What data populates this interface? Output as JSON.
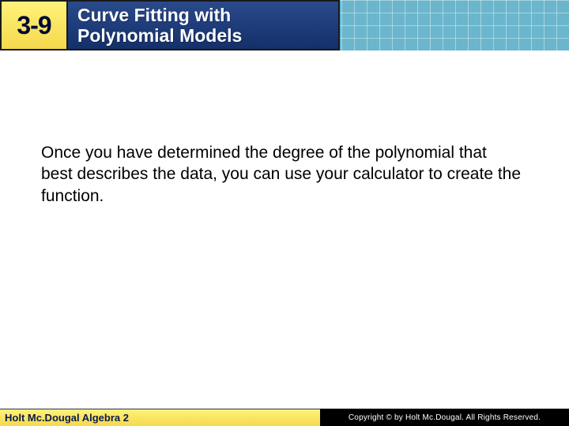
{
  "header": {
    "lesson_number": "3-9",
    "title_line1": "Curve Fitting with",
    "title_line2": "Polynomial Models"
  },
  "content": {
    "paragraph": "Once you have determined the degree of the polynomial that best describes the data, you can use your calculator to create the function."
  },
  "footer": {
    "left_text": "Holt Mc.Dougal Algebra 2",
    "right_text": "Copyright © by Holt Mc.Dougal. All Rights Reserved."
  }
}
